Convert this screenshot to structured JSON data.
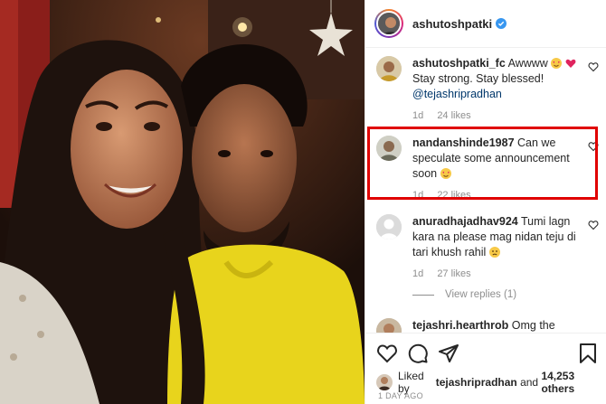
{
  "post": {
    "author": "ashutoshpatki",
    "verified": true
  },
  "comments": [
    {
      "username": "ashutoshpatki_fc",
      "text_before": "Awwww",
      "text_after": "Stay strong. Stay blessed! ",
      "mention": "@tejashripradhan",
      "time": "1d",
      "likes": "24 likes",
      "emojis": [
        "heart-eyes-emoji",
        "red-heart-emoji"
      ]
    },
    {
      "username": "nandanshinde1987",
      "text": "Can we speculate some announcement soon",
      "time": "1d",
      "likes": "22 likes",
      "emojis": [
        "heart-eyes-emoji"
      ],
      "highlighted": true
    },
    {
      "username": "anuradhajadhav924",
      "text": "Tumi lagn kara na please mag nidan teju di tari khush rahil",
      "time": "1d",
      "likes": "27 likes",
      "emojis": [
        "disappointed-emoji"
      ],
      "view_replies": "View replies (1)"
    },
    {
      "username": "tejashri.hearthrob",
      "text": "Omg the"
    }
  ],
  "likes": {
    "prefix": "Liked by ",
    "user": "tejashripradhan",
    "conjunction": " and ",
    "count": "14,253 others"
  },
  "date": "1 DAY AGO",
  "icons": [
    "heart-icon",
    "comment-icon",
    "share-icon",
    "bookmark-icon",
    "verified-badge-icon"
  ],
  "colors": {
    "highlight": "#e00000",
    "verified": "#3897f0",
    "link": "#00376b",
    "muted": "#8e8e8e",
    "photo_shirt": "#e8d41c"
  }
}
